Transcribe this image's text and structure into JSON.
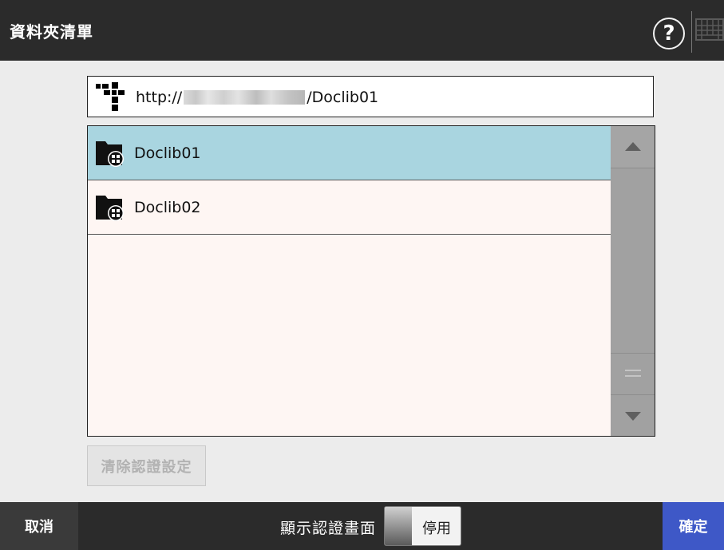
{
  "header": {
    "title": "資料夾清單",
    "help_label": "?",
    "keyboard_icon": "keyboard-icon"
  },
  "path": {
    "icon": "site-tree-icon",
    "prefix": "http://",
    "suffix": "/Doclib01"
  },
  "folders": [
    {
      "label": "Doclib01",
      "selected": true,
      "icon": "sharepoint-folder-icon"
    },
    {
      "label": "Doclib02",
      "selected": false,
      "icon": "sharepoint-folder-icon"
    }
  ],
  "scrollbar": {
    "up_icon": "triangle-up-icon",
    "grip_icon": "grip-icon",
    "down_icon": "triangle-down-icon"
  },
  "clear_button": {
    "label": "清除認證設定",
    "enabled": false
  },
  "footer": {
    "cancel_label": "取消",
    "auth_screen_label": "顯示認證畫面",
    "toggle_state_label": "停用",
    "ok_label": "確定"
  },
  "colors": {
    "topbar": "#2b2b2b",
    "selected_row": "#a9d5e0",
    "list_background": "#fef6f3",
    "ok_button": "#3e58c7"
  }
}
